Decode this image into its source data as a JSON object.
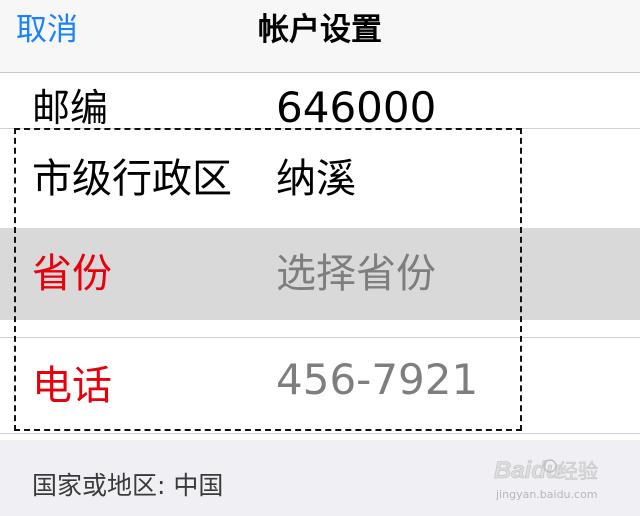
{
  "navbar": {
    "cancel_label": "取消",
    "title": "帐户设置"
  },
  "rows": {
    "zip": {
      "label": "邮编",
      "value": "646000"
    },
    "city": {
      "label": "市级行政区",
      "value": "纳溪"
    },
    "province": {
      "label": "省份",
      "value": "选择省份"
    },
    "phone": {
      "label": "电话",
      "value": "456-7921"
    }
  },
  "footer": {
    "country": "国家或地区: 中国"
  },
  "watermark": {
    "brand": "Baidu",
    "brand_cn": "经验",
    "url": "jingyan.baidu.com"
  },
  "colors": {
    "accent": "#1a82fb",
    "required_label": "#e8000b",
    "value_gray": "#7e7e7e",
    "selected_row": "#d9d9d9"
  }
}
